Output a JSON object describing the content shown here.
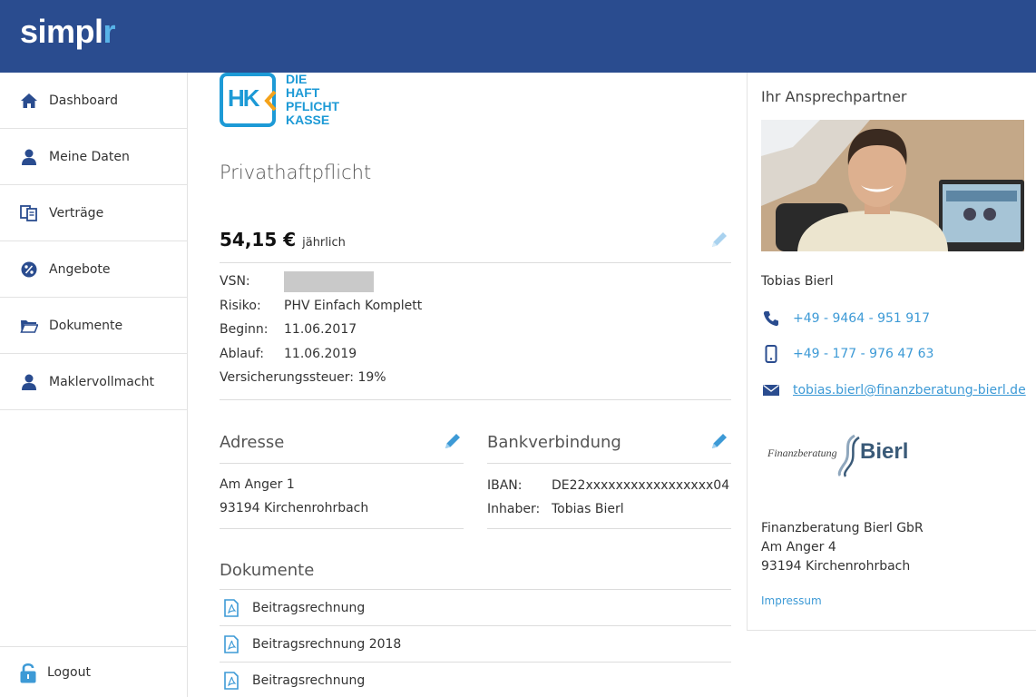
{
  "app": {
    "logo_main": "simpl",
    "logo_accent": "r",
    "brand_color": "#2a4c8f",
    "accent_color": "#3d9ad6"
  },
  "sidebar": {
    "items": [
      {
        "label": "Dashboard",
        "icon": "home-icon"
      },
      {
        "label": "Meine Daten",
        "icon": "user-icon"
      },
      {
        "label": "Verträge",
        "icon": "contracts-icon"
      },
      {
        "label": "Angebote",
        "icon": "percent-icon"
      },
      {
        "label": "Dokumente",
        "icon": "folder-icon"
      },
      {
        "label": "Maklervollmacht",
        "icon": "user-icon"
      }
    ],
    "logout_label": "Logout"
  },
  "insurer": {
    "logo_letters": "HK",
    "logo_line1": "DIE",
    "logo_line2": "HAFT",
    "logo_line3": "PFLICHT",
    "logo_line4": "KASSE"
  },
  "contract": {
    "product": "Privathaftpflicht",
    "price": "54,15 €",
    "period": "jährlich",
    "details": [
      {
        "key": "VSN:",
        "value": ""
      },
      {
        "key": "Risiko:",
        "value": "PHV Einfach Komplett"
      },
      {
        "key": "Beginn:",
        "value": "11.06.2017"
      },
      {
        "key": "Ablauf:",
        "value": "11.06.2019"
      }
    ],
    "tax": "Versicherungssteuer: 19%"
  },
  "address": {
    "title": "Adresse",
    "street": "Am Anger 1",
    "city": "93194 Kirchenrohrbach"
  },
  "bank": {
    "title": "Bankverbindung",
    "iban_label": "IBAN:",
    "iban": "DE22xxxxxxxxxxxxxxxxx04",
    "holder_label": "Inhaber:",
    "holder": "Tobias Bierl"
  },
  "documents": {
    "title": "Dokumente",
    "items": [
      "Beitragsrechnung",
      "Beitragsrechnung 2018",
      "Beitragsrechnung"
    ]
  },
  "contact_panel": {
    "title": "Ihr Ansprechpartner",
    "name": "Tobias Bierl",
    "phone": "+49 - 9464 - 951 917",
    "mobile": "+49 - 177 - 976 47 63",
    "email": "tobias.bierl@finanzberatung-bierl.de",
    "firm_logo_small": "Finanzberatung",
    "firm_logo_big": "Bierl",
    "firm_name": "Finanzberatung Bierl GbR",
    "firm_street": "Am Anger 4",
    "firm_city": "93194 Kirchenrohrbach",
    "impressum": "Impressum"
  }
}
